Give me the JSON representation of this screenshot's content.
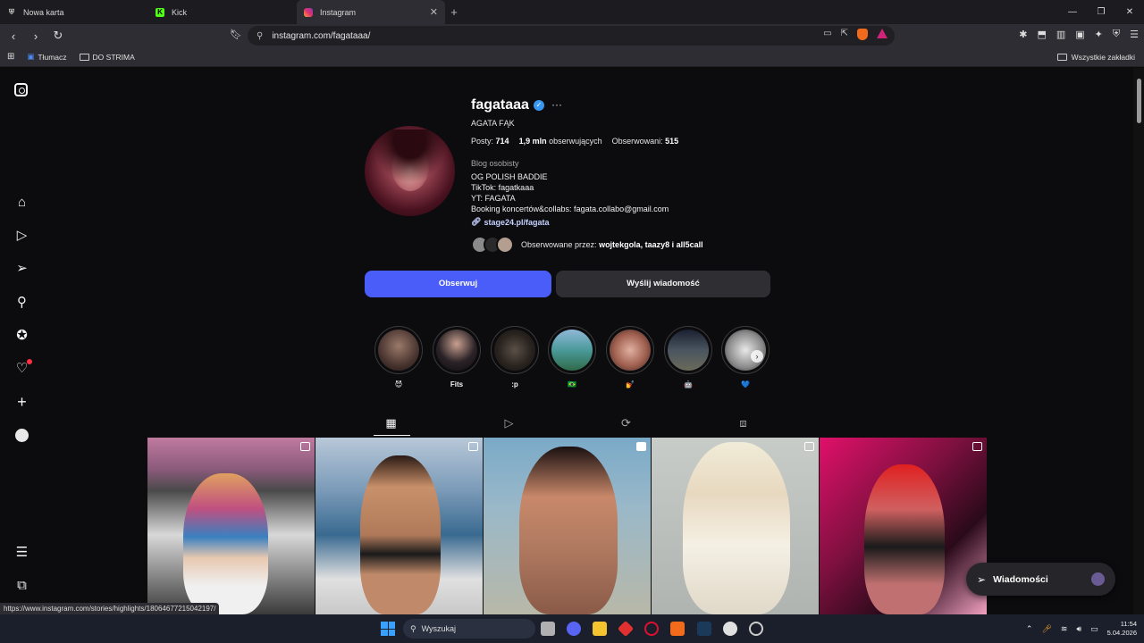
{
  "browser": {
    "tabs": [
      {
        "title": "Nowa karta",
        "icon": "shield-icon"
      },
      {
        "title": "Kick",
        "icon": "kick-icon"
      },
      {
        "title": "Instagram",
        "icon": "instagram-icon"
      }
    ],
    "url": "instagram.com/fagataaa/",
    "bookmarks": [
      {
        "label": "Tłumacz"
      },
      {
        "label": "DO STRIMA"
      }
    ],
    "all_bookmarks_label": "Wszystkie zakładki",
    "status_url": "https://www.instagram.com/stories/highlights/18064677215042197/"
  },
  "profile": {
    "username": "fagataaa",
    "full_name": "AGATA FĄK",
    "posts_label": "Posty:",
    "posts_count": "714",
    "followers_count": "1,9 mln",
    "followers_label": "obserwujących",
    "following_label": "Obserwowani:",
    "following_count": "515",
    "category": "Blog osobisty",
    "bio_lines": [
      "OG POLISH BADDIE",
      "TikTok: fagatkaaa",
      "YT: FAGATA",
      "Booking koncertów&collabs: fagata.collabo@gmail.com"
    ],
    "link": "stage24.pl/fagata",
    "followed_by_prefix": "Obserwowane przez:",
    "followed_by_names": "wojtekgola, taazy8 i all5call",
    "follow_button": "Obserwuj",
    "message_button": "Wyślij wiadomość"
  },
  "highlights": [
    {
      "label": "😈"
    },
    {
      "label": "Fits"
    },
    {
      "label": ":p"
    },
    {
      "label": "🇧🇷"
    },
    {
      "label": "💅"
    },
    {
      "label": "🤖"
    },
    {
      "label": "💙"
    }
  ],
  "messages_pill": {
    "label": "Wiadomości"
  },
  "taskbar": {
    "search_placeholder": "Wyszukaj",
    "time": "11:54",
    "date": "5.04.2026"
  }
}
